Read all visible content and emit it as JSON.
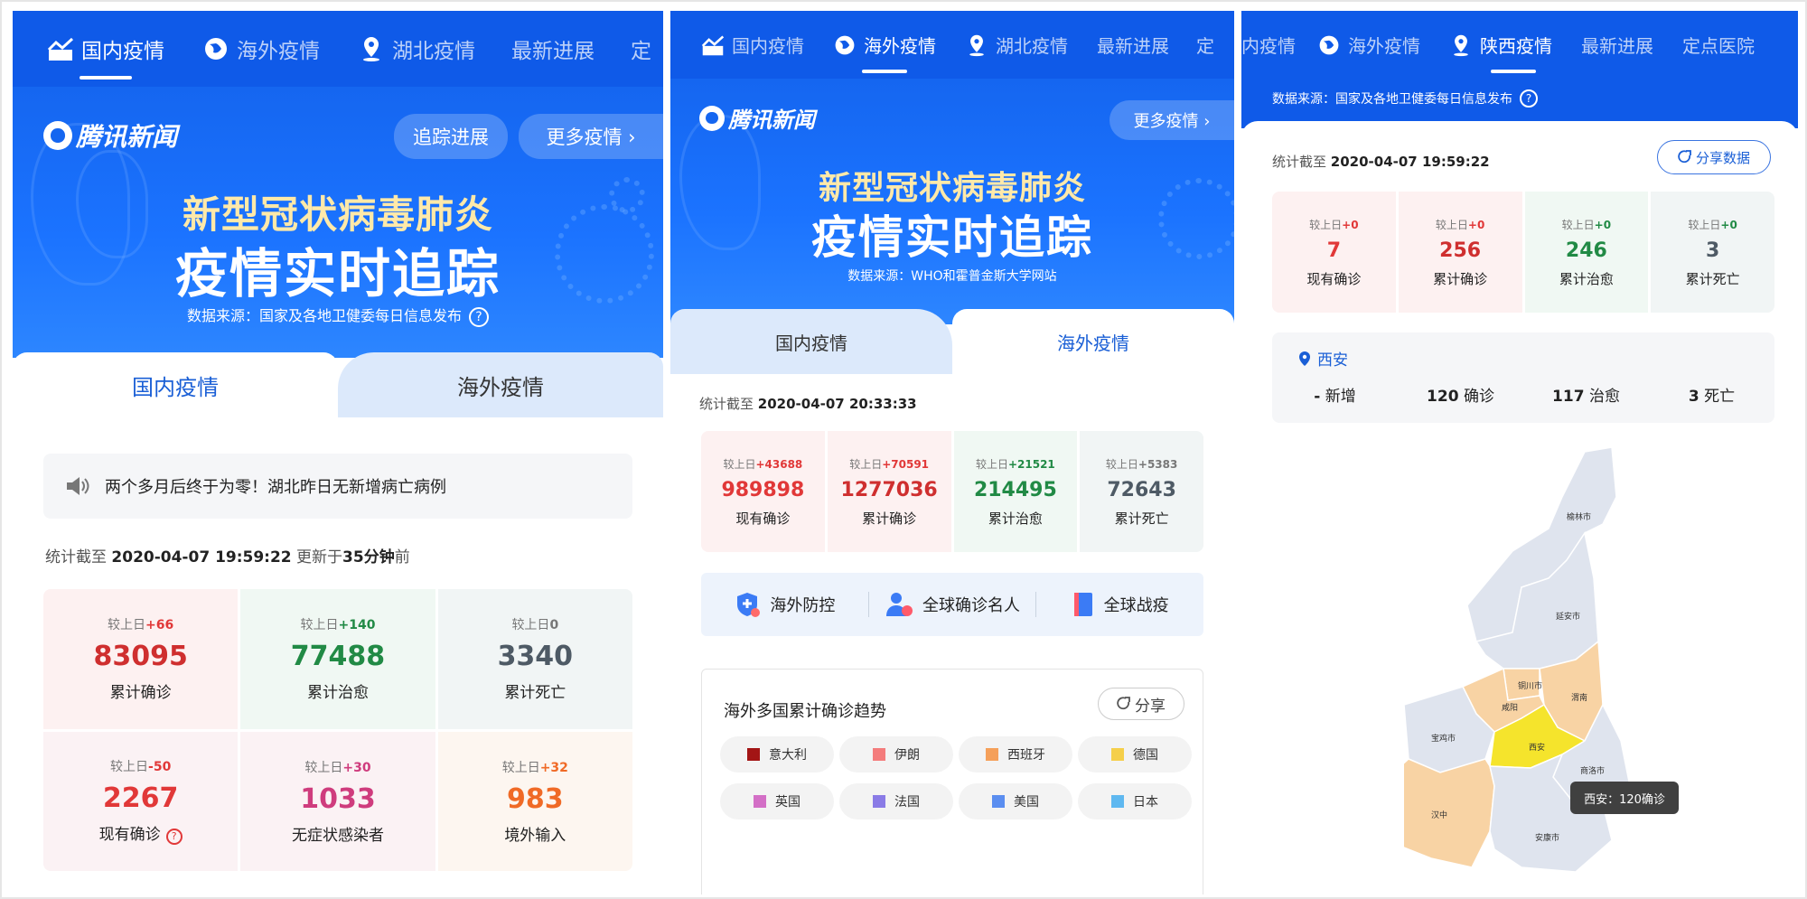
{
  "panel1": {
    "nav": [
      "国内疫情",
      "海外疫情",
      "湖北疫情",
      "最新进展",
      "定"
    ],
    "logo_text": "腾讯新闻",
    "buttons": {
      "track": "追踪进展",
      "more": "更多疫情 ›"
    },
    "hero": {
      "title": "新型冠状病毒肺炎",
      "title2": "疫情实时追踪",
      "source": "数据来源：国家及各地卫健委每日信息发布",
      "help_glyph": "?"
    },
    "tabs": [
      "国内疫情",
      "海外疫情"
    ],
    "notice": "两个多月后终于为零！湖北昨日无新增病亡病例",
    "stamp": {
      "prefix": "统计截至",
      "time": "2020-04-07 19:59:22",
      "mid": "更新于",
      "minutes": "35分钟",
      "suffix": "前"
    },
    "stats": [
      {
        "cmp": "较上日",
        "delta": "+66",
        "value": "83095",
        "label": "累计确诊"
      },
      {
        "cmp": "较上日",
        "delta": "+140",
        "value": "77488",
        "label": "累计治愈"
      },
      {
        "cmp": "较上日",
        "delta": "0",
        "value": "3340",
        "label": "累计死亡"
      },
      {
        "cmp": "较上日",
        "delta": "-50",
        "value": "2267",
        "label": "现有确诊"
      },
      {
        "cmp": "较上日",
        "delta": "+30",
        "value": "1033",
        "label": "无症状感染者"
      },
      {
        "cmp": "较上日",
        "delta": "+32",
        "value": "983",
        "label": "境外输入"
      }
    ],
    "colors": {
      "nav_bg": "#0f5ae8",
      "accent_red": "#e13838",
      "accent_green": "#218a45"
    }
  },
  "panel2": {
    "nav": [
      "国内疫情",
      "海外疫情",
      "湖北疫情",
      "最新进展",
      "定"
    ],
    "logo_text": "腾讯新闻",
    "buttons": {
      "more": "更多疫情 ›"
    },
    "hero": {
      "title": "新型冠状病毒肺炎",
      "title2": "疫情实时追踪",
      "source": "数据来源：WHO和霍普金斯大学网站"
    },
    "tabs": [
      "国内疫情",
      "海外疫情"
    ],
    "stamp": {
      "prefix": "统计截至",
      "time": "2020-04-07 20:33:33"
    },
    "stats": [
      {
        "cmp": "较上日",
        "delta": "+43688",
        "value": "989898",
        "label": "现有确诊"
      },
      {
        "cmp": "较上日",
        "delta": "+70591",
        "value": "1277036",
        "label": "累计确诊"
      },
      {
        "cmp": "较上日",
        "delta": "+21521",
        "value": "214495",
        "label": "累计治愈"
      },
      {
        "cmp": "较上日",
        "delta": "+5383",
        "value": "72643",
        "label": "累计死亡"
      }
    ],
    "quick": [
      "海外防控",
      "全球确诊名人",
      "全球战疫"
    ],
    "trend": {
      "title": "海外多国累计确诊趋势",
      "share": "分享",
      "legend": [
        {
          "name": "意大利",
          "color": "#a31515"
        },
        {
          "name": "伊朗",
          "color": "#f47c7c"
        },
        {
          "name": "西班牙",
          "color": "#f5a05a"
        },
        {
          "name": "德国",
          "color": "#f5cf4a"
        },
        {
          "name": "英国",
          "color": "#d36fc6"
        },
        {
          "name": "法国",
          "color": "#8a7be6"
        },
        {
          "name": "美国",
          "color": "#5b8ef0"
        },
        {
          "name": "日本",
          "color": "#5fb8f0"
        }
      ]
    }
  },
  "panel3": {
    "nav": [
      "内疫情",
      "海外疫情",
      "陕西疫情",
      "最新进展",
      "定点医院"
    ],
    "source": "数据来源：国家及各地卫健委每日信息发布",
    "stamp": {
      "prefix": "统计截至",
      "time": "2020-04-07 19:59:22"
    },
    "share": "分享数据",
    "stats": [
      {
        "cmp": "较上日",
        "delta": "+0",
        "value": "7",
        "label": "现有确诊"
      },
      {
        "cmp": "较上日",
        "delta": "+0",
        "value": "256",
        "label": "累计确诊"
      },
      {
        "cmp": "较上日",
        "delta": "+0",
        "value": "246",
        "label": "累计治愈"
      },
      {
        "cmp": "较上日",
        "delta": "+0",
        "value": "3",
        "label": "累计死亡"
      }
    ],
    "city": {
      "name": "西安",
      "new": {
        "value": "-",
        "unit": "新增"
      },
      "confirmed": {
        "value": "120",
        "unit": "确诊"
      },
      "cured": {
        "value": "117",
        "unit": "治愈"
      },
      "dead": {
        "value": "3",
        "unit": "死亡"
      }
    },
    "map_labels": [
      "榆林市",
      "延安市",
      "铜川市",
      "渭南",
      "咸阳",
      "宝鸡市",
      "西安",
      "商洛市",
      "汉中",
      "安康市"
    ],
    "tooltip": "西安：120确诊"
  }
}
